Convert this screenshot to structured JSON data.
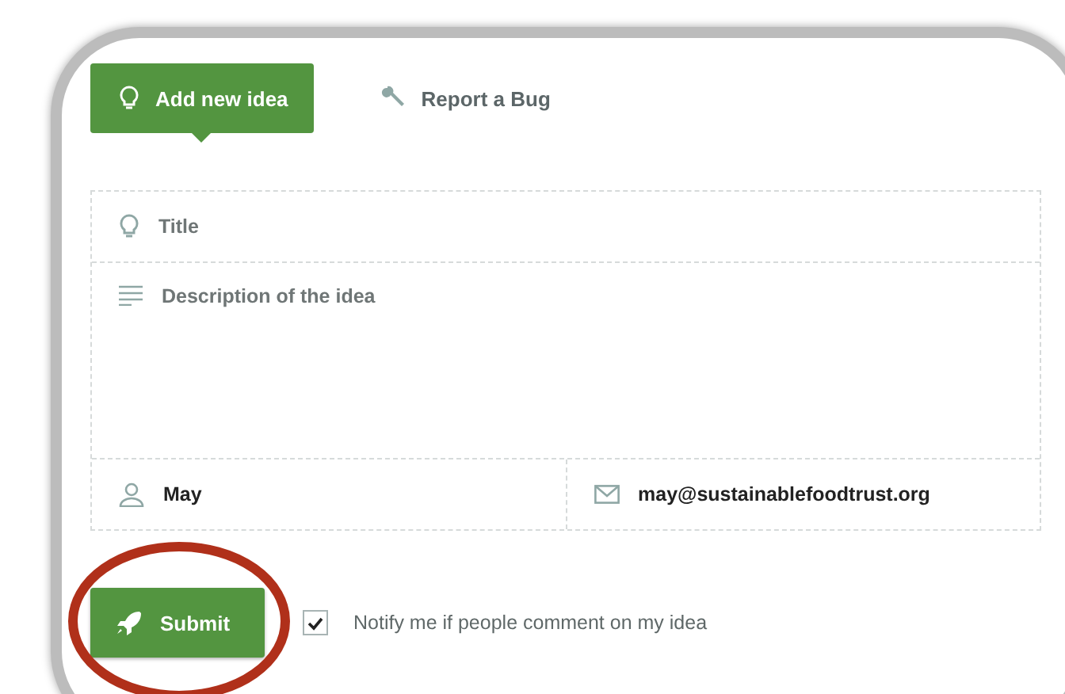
{
  "tabs": [
    {
      "label": "Add new idea",
      "selected": true
    },
    {
      "label": "Report a Bug",
      "selected": false
    }
  ],
  "form": {
    "title": {
      "placeholder": "Title"
    },
    "description": {
      "placeholder": "Description of the idea"
    },
    "name": {
      "value": "May"
    },
    "email": {
      "value": "may@sustainablefoodtrust.org"
    }
  },
  "submit_button": "Submit",
  "notify": {
    "label": "Notify me if people comment on my idea",
    "checked": true
  }
}
